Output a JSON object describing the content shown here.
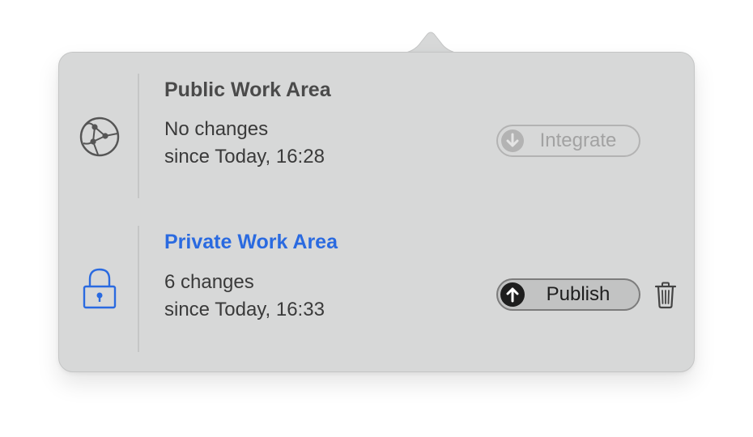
{
  "public_area": {
    "title": "Public Work Area",
    "status_line1": "No changes",
    "status_line2": "since Today, 16:28",
    "icon": "network-globe-icon",
    "action": {
      "label": "Integrate",
      "icon": "arrow-down-circle-icon",
      "enabled": false
    }
  },
  "private_area": {
    "title": "Private Work Area",
    "status_line1": "6 changes",
    "status_line2": "since Today, 16:33",
    "icon": "lock-icon",
    "action": {
      "label": "Publish",
      "icon": "arrow-up-circle-icon",
      "enabled": true
    },
    "discard_icon": "trash-icon"
  },
  "colors": {
    "popover_background": "#d7d8d8",
    "private_accent": "#2a6ae0",
    "disabled_text": "#a2a2a2",
    "text": "#3a3a3a"
  }
}
